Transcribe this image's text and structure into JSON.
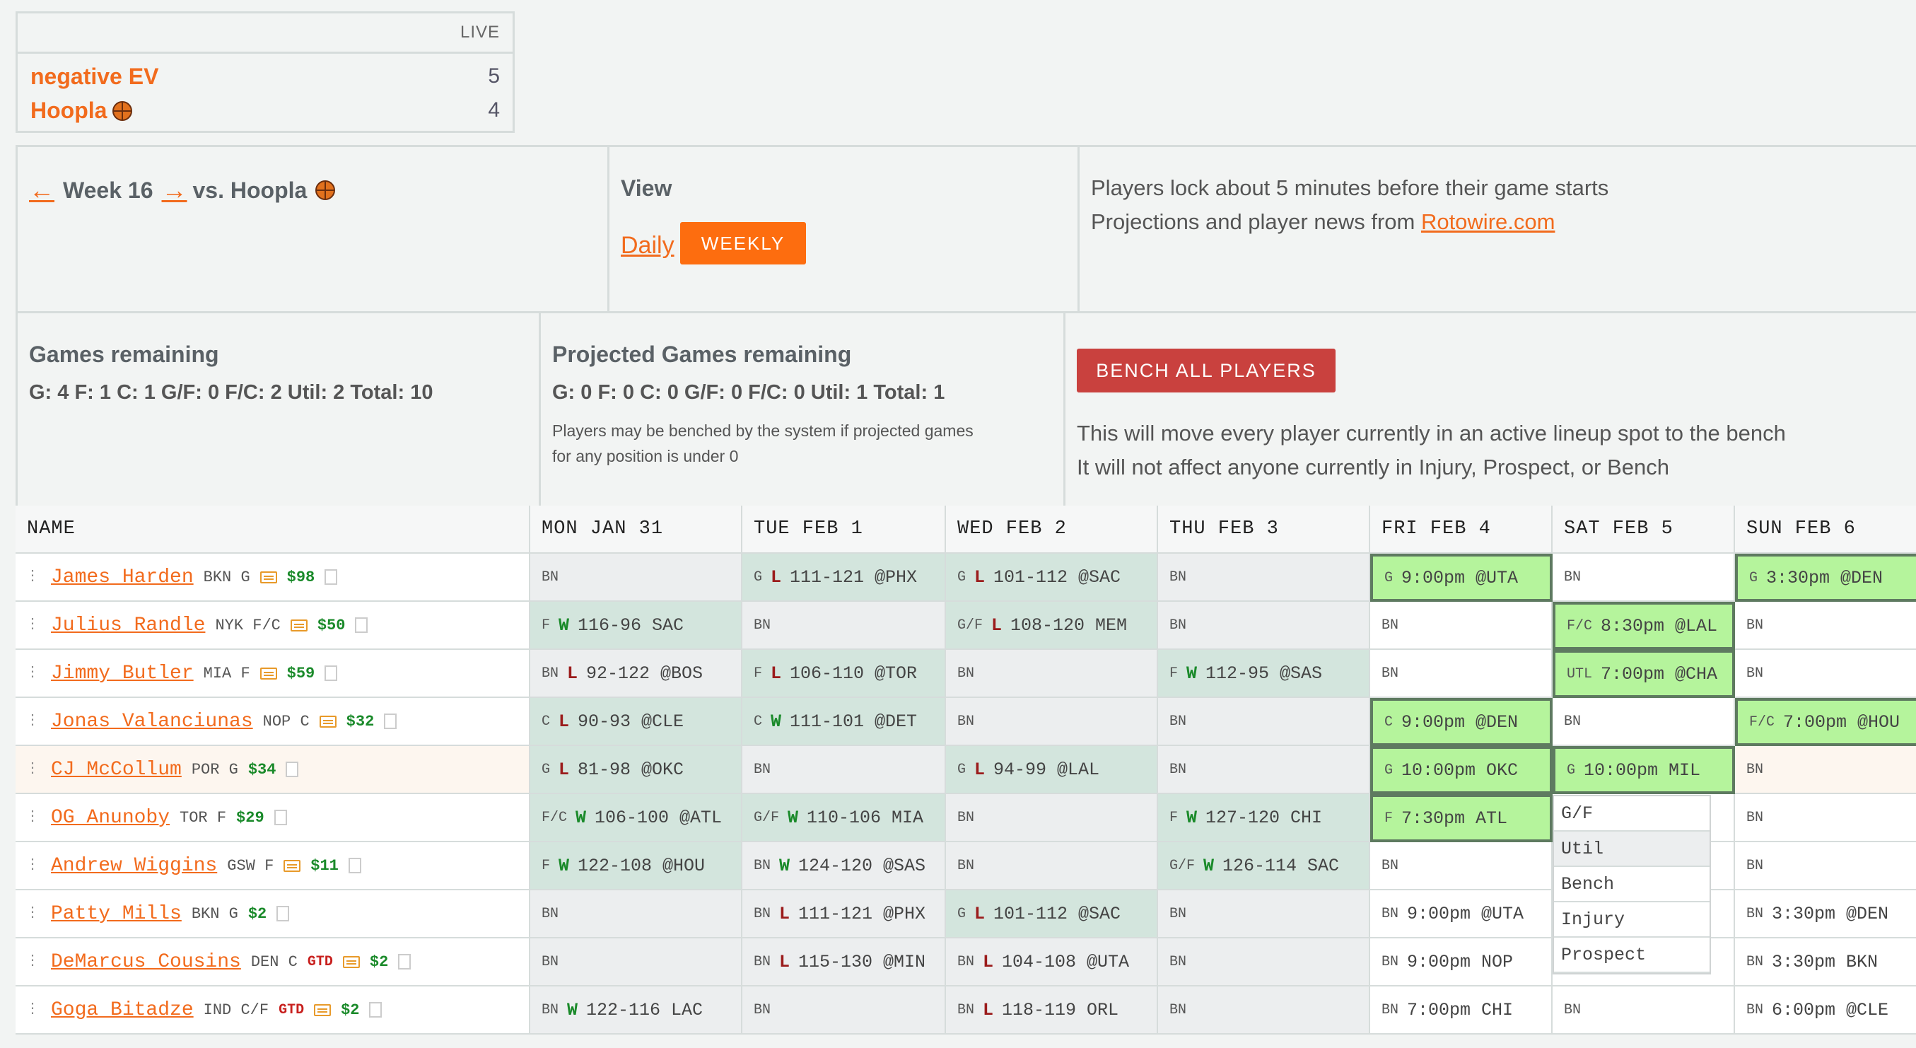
{
  "scoreboard": {
    "status": "LIVE",
    "teams": [
      {
        "name": "negative EV",
        "score": "5"
      },
      {
        "name": "Hoopla",
        "score": "4"
      }
    ]
  },
  "week": {
    "prev_arrow": "←",
    "label": "Week 16",
    "next_arrow": "→",
    "opponent": "vs. Hoopla"
  },
  "view": {
    "title": "View",
    "daily": "Daily",
    "weekly": "WEEKLY"
  },
  "info": {
    "line1": "Players lock about 5 minutes before their game starts",
    "line2_prefix": "Projections and player news from ",
    "line2_link": "Rotowire.com"
  },
  "games_remaining": {
    "title": "Games remaining",
    "counts": "G: 4 F: 1 C: 1 G/F: 0 F/C: 2 Util: 2 Total: 10"
  },
  "projected": {
    "title": "Projected Games remaining",
    "counts": "G: 0 F: 0 C: 0 G/F: 0 F/C: 0 Util: 1 Total: 1",
    "note": "Players may be benched by the system if projected games for any position is under 0"
  },
  "bench": {
    "button": "BENCH ALL PLAYERS",
    "line1": "This will move every player currently in an active lineup spot to the bench",
    "line2": "It will not affect anyone currently in Injury, Prospect, or Bench"
  },
  "table": {
    "headers": [
      "NAME",
      "MON JAN 31",
      "TUE FEB 1",
      "WED FEB 2",
      "THU FEB 3",
      "FRI FEB 4",
      "SAT FEB 5",
      "SUN FEB 6"
    ],
    "players": [
      {
        "name": "James Harden",
        "team": "BKN",
        "pos": "G",
        "gtd": "",
        "salary": "$98",
        "news": true,
        "days": [
          [
            "BN",
            "",
            "",
            ""
          ],
          [
            "G",
            "L",
            "111-121 @PHX",
            "green"
          ],
          [
            "G",
            "L",
            "101-112 @SAC",
            "green"
          ],
          [
            "BN",
            "",
            "",
            ""
          ],
          [
            "G",
            "",
            "9:00pm @UTA",
            "live"
          ],
          [
            "BN",
            "",
            "",
            "white"
          ],
          [
            "G",
            "",
            "3:30pm @DEN",
            "live"
          ]
        ]
      },
      {
        "name": "Julius Randle",
        "team": "NYK",
        "pos": "F/C",
        "gtd": "",
        "salary": "$50",
        "news": true,
        "days": [
          [
            "F",
            "W",
            "116-96 SAC",
            "green"
          ],
          [
            "BN",
            "",
            "",
            ""
          ],
          [
            "G/F",
            "L",
            "108-120 MEM",
            "green"
          ],
          [
            "BN",
            "",
            "",
            ""
          ],
          [
            "BN",
            "",
            "",
            "white"
          ],
          [
            "F/C",
            "",
            "8:30pm @LAL",
            "live"
          ],
          [
            "BN",
            "",
            "",
            "white"
          ]
        ]
      },
      {
        "name": "Jimmy Butler",
        "team": "MIA",
        "pos": "F",
        "gtd": "",
        "salary": "$59",
        "news": true,
        "days": [
          [
            "BN",
            "L",
            "92-122 @BOS",
            ""
          ],
          [
            "F",
            "L",
            "106-110 @TOR",
            "green"
          ],
          [
            "BN",
            "",
            "",
            ""
          ],
          [
            "F",
            "W",
            "112-95 @SAS",
            "green"
          ],
          [
            "BN",
            "",
            "",
            "white"
          ],
          [
            "UTL",
            "",
            "7:00pm @CHA",
            "live"
          ],
          [
            "BN",
            "",
            "",
            "white"
          ]
        ]
      },
      {
        "name": "Jonas Valanciunas",
        "team": "NOP",
        "pos": "C",
        "gtd": "",
        "salary": "$32",
        "news": true,
        "days": [
          [
            "C",
            "L",
            "90-93 @CLE",
            "green"
          ],
          [
            "C",
            "W",
            "111-101 @DET",
            "green"
          ],
          [
            "BN",
            "",
            "",
            ""
          ],
          [
            "BN",
            "",
            "",
            ""
          ],
          [
            "C",
            "",
            "9:00pm @DEN",
            "live"
          ],
          [
            "BN",
            "",
            "",
            "white"
          ],
          [
            "F/C",
            "",
            "7:00pm @HOU",
            "live"
          ]
        ]
      },
      {
        "name": "CJ McCollum",
        "team": "POR",
        "pos": "G",
        "gtd": "",
        "salary": "$34",
        "news": false,
        "days": [
          [
            "G",
            "L",
            "81-98 @OKC",
            "green"
          ],
          [
            "BN",
            "",
            "",
            ""
          ],
          [
            "G",
            "L",
            "94-99 @LAL",
            "green"
          ],
          [
            "BN",
            "",
            "",
            ""
          ],
          [
            "G",
            "",
            "10:00pm OKC",
            "live"
          ],
          [
            "G",
            "",
            "10:00pm MIL",
            "live"
          ],
          [
            "BN",
            "",
            "",
            "white"
          ]
        ]
      },
      {
        "name": "OG Anunoby",
        "team": "TOR",
        "pos": "F",
        "gtd": "",
        "salary": "$29",
        "news": false,
        "days": [
          [
            "F/C",
            "W",
            "106-100 @ATL",
            "green"
          ],
          [
            "G/F",
            "W",
            "110-106 MIA",
            "green"
          ],
          [
            "BN",
            "",
            "",
            ""
          ],
          [
            "F",
            "W",
            "127-120 CHI",
            "green"
          ],
          [
            "F",
            "",
            "7:30pm ATL",
            "live"
          ],
          [
            "G/F",
            "",
            "",
            "white"
          ],
          [
            "BN",
            "",
            "",
            "white"
          ]
        ]
      },
      {
        "name": "Andrew Wiggins",
        "team": "GSW",
        "pos": "F",
        "gtd": "",
        "salary": "$11",
        "news": true,
        "days": [
          [
            "F",
            "W",
            "122-108 @HOU",
            "green"
          ],
          [
            "BN",
            "W",
            "124-120 @SAS",
            ""
          ],
          [
            "BN",
            "",
            "",
            ""
          ],
          [
            "G/F",
            "W",
            "126-114 SAC",
            "green"
          ],
          [
            "BN",
            "",
            "",
            "white"
          ],
          [
            "",
            "",
            "",
            "white"
          ],
          [
            "BN",
            "",
            "",
            "white"
          ]
        ]
      },
      {
        "name": "Patty Mills",
        "team": "BKN",
        "pos": "G",
        "gtd": "",
        "salary": "$2",
        "news": false,
        "days": [
          [
            "BN",
            "",
            "",
            ""
          ],
          [
            "BN",
            "L",
            "111-121 @PHX",
            ""
          ],
          [
            "G",
            "L",
            "101-112 @SAC",
            "green"
          ],
          [
            "BN",
            "",
            "",
            ""
          ],
          [
            "BN",
            "",
            "9:00pm @UTA",
            "white"
          ],
          [
            "",
            "",
            "",
            "white"
          ],
          [
            "BN",
            "",
            "3:30pm @DEN",
            "white"
          ]
        ]
      },
      {
        "name": "DeMarcus Cousins",
        "team": "DEN",
        "pos": "C",
        "gtd": "GTD",
        "salary": "$2",
        "news": true,
        "days": [
          [
            "BN",
            "",
            "",
            ""
          ],
          [
            "BN",
            "L",
            "115-130 @MIN",
            ""
          ],
          [
            "BN",
            "L",
            "104-108 @UTA",
            ""
          ],
          [
            "BN",
            "",
            "",
            ""
          ],
          [
            "BN",
            "",
            "9:00pm NOP",
            "white"
          ],
          [
            "",
            "",
            "",
            "white"
          ],
          [
            "BN",
            "",
            "3:30pm BKN",
            "white"
          ]
        ]
      },
      {
        "name": "Goga Bitadze",
        "team": "IND",
        "pos": "C/F",
        "gtd": "GTD",
        "salary": "$2",
        "news": true,
        "days": [
          [
            "BN",
            "W",
            "122-116 LAC",
            ""
          ],
          [
            "BN",
            "",
            "",
            ""
          ],
          [
            "BN",
            "L",
            "118-119 ORL",
            ""
          ],
          [
            "BN",
            "",
            "",
            ""
          ],
          [
            "BN",
            "",
            "7:00pm CHI",
            "white"
          ],
          [
            "BN",
            "",
            "",
            "white"
          ],
          [
            "BN",
            "",
            "6:00pm @CLE",
            "white"
          ]
        ]
      }
    ]
  },
  "dropdown": {
    "options": [
      "G/F",
      "Util",
      "Bench",
      "Injury",
      "Prospect"
    ],
    "selected": "Util"
  }
}
